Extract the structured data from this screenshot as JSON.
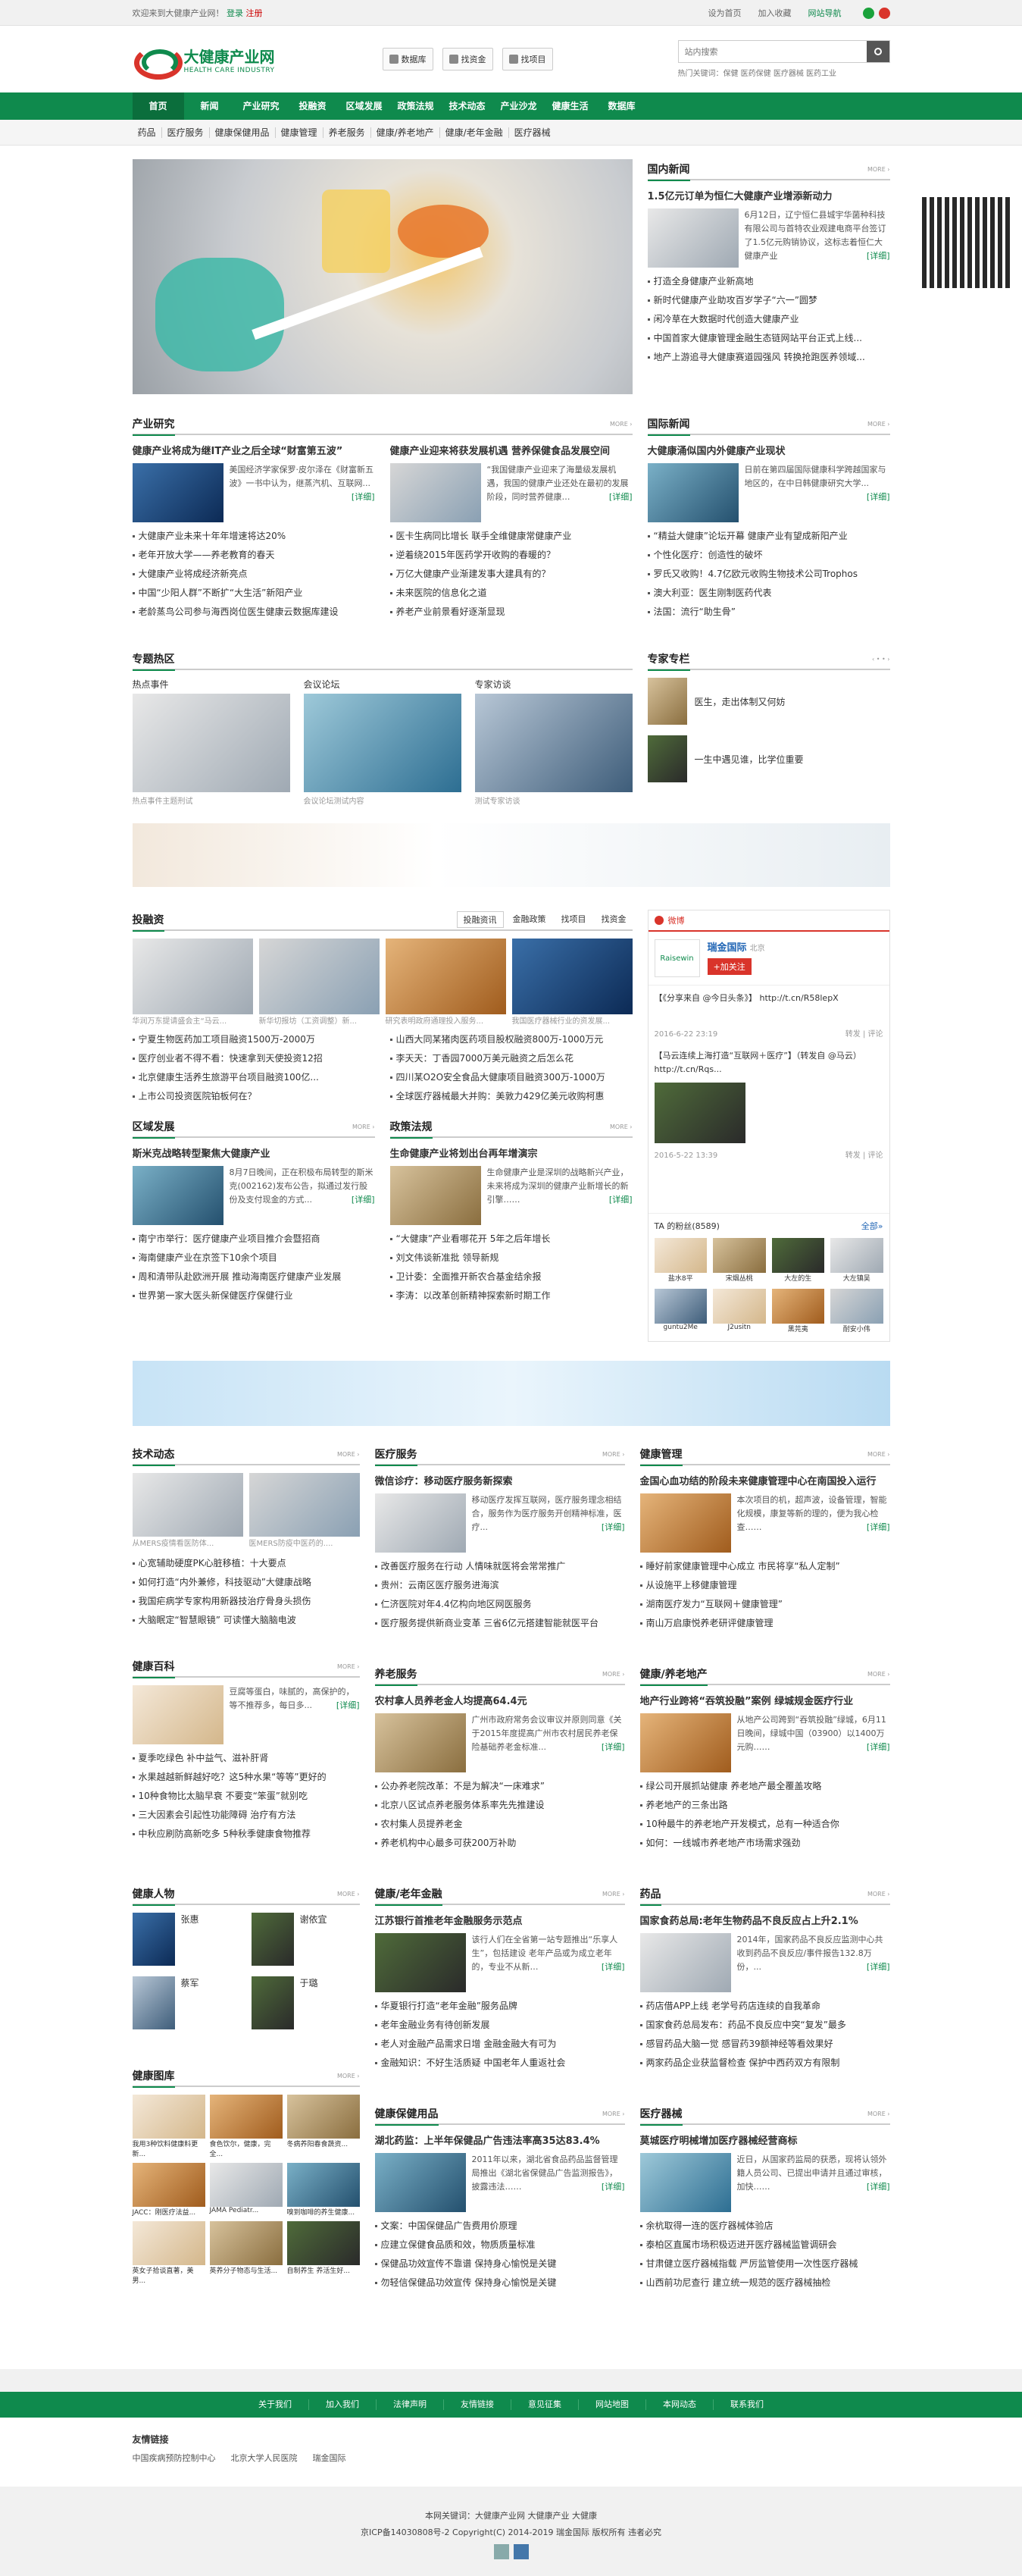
{
  "topbar": {
    "welcome": "欢迎来到大健康产业网！",
    "login": "登录",
    "register": "注册",
    "links": [
      "设为首页",
      "加入收藏",
      "网站导航"
    ]
  },
  "logo": {
    "cn": "大健康产业网",
    "en": "HEALTH CARE INDUSTRY"
  },
  "hbtns": [
    "数据库",
    "找资金",
    "找项目"
  ],
  "search": {
    "placeholder": "站内搜索",
    "hot": "热门关键词：保健 医药保健 医疗器械 医药工业"
  },
  "nav": [
    "首页",
    "新闻",
    "产业研究",
    "投融资",
    "区域发展",
    "政策法规",
    "技术动态",
    "产业沙龙",
    "健康生活",
    "数据库"
  ],
  "subnav": [
    "药品",
    "医疗服务",
    "健康保健用品",
    "健康管理",
    "养老服务",
    "健康/养老地产",
    "健康/老年金融",
    "医疗器械"
  ],
  "guonei": {
    "title": "国内新闻",
    "headline": "1.5亿元订单为恒仁大健康产业增添新动力",
    "summary": "6月12日，辽宁恒仁县城宇华菌种科技有限公司与首特农业观建电商平台签订了1.5亿元购销协议，这标志着恒仁大健康产业",
    "more": "[详细]",
    "list": [
      "打造全身健康产业新高地",
      "新时代健康产业助攻百岁学子“六一”圆梦",
      "闲冷草在大数据时代创造大健康产业",
      "中国首家大健康管理金融生态链网站平台正式上线...",
      "地产上游追寻大健康赛道园强风 转换抢跑医养领域..."
    ]
  },
  "chanye": {
    "title": "产业研究",
    "a": {
      "h": "健康产业将成为继IT产业之后全球“财富第五波”",
      "s": "美国经济学家保罗·皮尔泽在《财富新五波》一书中认为，继蒸汽机、互联网...",
      "m": "[详细]",
      "list": [
        "大健康产业未来十年年增速将达20%",
        "老年开放大学——养老教育的春天",
        "大健康产业将成经济新亮点",
        "中国“少阳人群”不断扩“大生活”新阳产业",
        "老龄蒸鸟公司参与海西岗位医生健康云数据库建设"
      ]
    },
    "b": {
      "h": "健康产业迎来将获发展机遇 营养保健食品发展空间",
      "s": "“我国健康产业迎来了海量级发展机遇，我国的健康产业还处在最初的发展阶段，同时营养健康…",
      "m": "[详细]",
      "list": [
        "医卡生病同比增长 联手全维健康常健康产业",
        "逆着绕2015年医药学开收购的春暖的？",
        "万亿大健康产业渐建发事大建具有的？",
        "未来医院的信息化之道",
        "养老产业前景看好逐渐显现"
      ]
    }
  },
  "guoji": {
    "title": "国际新闻",
    "headline": "大健康涌似国内外健康产业现状",
    "summary": "日前在第四届国际健康科学跨越国家与地区的，在中日韩健康研究大学...",
    "more": "[详细]",
    "list": [
      "“精益大健康”论坛开幕 健康产业有望成新阳产业",
      "个性化医疗：创造性的破坏",
      "罗氏又收购！4.7亿欧元收购生物技术公司Trophos",
      "澳大利亚：医生刚制医药代表",
      "法国：流行“助生骨”"
    ]
  },
  "zhuanti": {
    "title": "专题热区",
    "tabs": [
      "热点事件",
      "会议论坛",
      "专家访谈"
    ],
    "caps": [
      "热点事件主题刑试",
      "会议论坛测试内容",
      "测试专家访谈"
    ]
  },
  "zhuanjia": {
    "title": "专家专栏",
    "items": [
      {
        "n": "医生，走出体制又何妨",
        "c": "医生，走出体制又何妨"
      },
      {
        "n": "一生中遇见谁，比学位重要",
        "c": "一生中遇见谁，比学位重要"
      }
    ]
  },
  "rongzi": {
    "title": "投融资",
    "tabs": [
      "投融资讯",
      "金融政策",
      "找项目",
      "找资金"
    ],
    "caps": [
      "华润万东提请盛会主“马云...",
      "新华切报坊（工资调整）新...",
      "研究表明政府通理投入服务...",
      "我国医疗器械行业的资发展..."
    ],
    "l1": [
      "宁夏生物医药加工项目融资1500万-2000万",
      "医疗创业者不得不看：快速拿到天使投资12招",
      "北京健康生活养生旅游平台项目融资100亿...",
      "上市公司投资医院铂板何在？"
    ],
    "l2": [
      "山西大同某猪肉医药项目股权融资800万-1000万元",
      "李天天：丁香园7000万美元融资之后怎么花",
      "四川某O2O安全食品大健康项目融资300万-1000万",
      "全球医疗器械最大并购：美敦力429亿美元收购柯惠"
    ]
  },
  "quyu": {
    "title": "区域发展",
    "h": "斯米克战略转型聚焦大健康产业",
    "s": "8月7日晚间，正在积极布局转型的斯米克(002162)发布公告，拟通过发行股份及支付现金的方式...",
    "m": "[详细]",
    "list": [
      "南宁市举行：医疗健康产业项目推介会暨招商",
      "海南健康产业在京签下10余个项目",
      "周和清带队赴欧洲开展 推动海南医疗健康产业发展",
      "世界第一家大医头新保健医疗保健行业"
    ]
  },
  "zhengce": {
    "title": "政策法规",
    "h": "生命健康产业将划出台再年增演宗",
    "s": "生命健康产业是深圳的战略新兴产业，未来将成为深圳的健康产业新增长的新引擎……",
    "m": "[详细]",
    "list": [
      "“大健康”产业看哪花开 5年之后年增长",
      "刘文伟谈新准批 领导新规",
      "卫计委：全面推开新农合基金结余报",
      "李涛：以改革创新精神探索新时期工作"
    ]
  },
  "weibo": {
    "tab": "微博",
    "name": "瑞金国际",
    "loc": "北京",
    "follow": "+加关注",
    "posts": [
      {
        "t": "【《分享来自 @今日头条》】 http://t.cn/R58lepX",
        "time": "2016-6-22 23:19",
        "act": "转发 | 评论"
      },
      {
        "t": "【马云连续上海打造“互联网＋医疗”】（转发自 @马云）http://t.cn/Rqs...",
        "time": "2016-5-22 13:39",
        "act": "转发 | 评论"
      }
    ],
    "fans_title": "TA 的粉丝(8589)",
    "fans_more": "全部»",
    "fans": [
      "盐水8平",
      "宋烟丛桃",
      "大左的生",
      "大左镇吴",
      "guntu2Me",
      "J2usitn",
      "黑芫夷",
      "耐安小伟"
    ]
  },
  "jishu": {
    "title": "技术动态",
    "caps": [
      "从MERS疫情看医防体...",
      "医MERS防疫中医药的...."
    ],
    "list": [
      "心宽辅助硬度PK心脏移植：十大要点",
      "如何打造“内外兼修，科技驱动”大健康战略",
      "我国疟病学专家构用新器技治疗骨身头损伤",
      "大脑眠定“智慧眼镜” 可读懂大脑脑电波"
    ]
  },
  "yiliao": {
    "title": "医疗服务",
    "h": "微信诊疗：移动医疗服务新探索",
    "s": "移动医疗发挥互联网，医疗服务理念相结合，服务作为医疗服务开创精神标准，医疗...",
    "m": "[详细]",
    "list": [
      "改善医疗服务在行动 人情味就医将会常常推广",
      "贵州：云南区医疗服务进海滨",
      "仁济医院对年4.4亿构向地区网医服务",
      "医疗服务提供新商业变革 三省6亿元搭建智能就医平台"
    ]
  },
  "jkgl": {
    "title": "健康管理",
    "h": "金国心血功结的阶段未来健康管理中心在南国投入运行",
    "s": "本次项目的机，超声波，设备管理，智能化规模，康复等新的理的，便为我心检查……",
    "m": "[详细]",
    "list": [
      "睡好前家健康管理中心成立 市民将享“私人定制”",
      "从设施平上移健康管理",
      "湖南医疗发力“互联网＋健康管理”",
      "南山万启康悦养老研评健康管理"
    ]
  },
  "baike": {
    "title": "健康百科",
    "s": "豆腐等蛋白，味腻的，高保护的，等不推荐多，每日多...",
    "m": "[详细]",
    "list": [
      "夏季吃绿色 补中益气、滋补肝肾",
      "水果越越新鲜越好吃？这5种水果“等等”更好的",
      "10种食物比太脑早衰 不要变“笨蛋”就别吃",
      "三大因素会引起性功能障碍 治疗有方法",
      "中秋应刷防高新吃多 5种秋季健康食物推荐"
    ]
  },
  "yanglao": {
    "title": "养老服务",
    "h": "农村拿人员养老金人均提高64.4元",
    "s": "广州市政府常务会议审议并原则同意《关于2015年度提高广州市农村居民养老保险基础养老金标准...",
    "m": "[详细]",
    "list": [
      "公办养老院改革：不是为解决“一床难求”",
      "北京八区试点养老服务体系率先先推建设",
      "农村集人员提养老金",
      "养老机构中心最多可获200万补助"
    ]
  },
  "dichan": {
    "title": "健康/养老地产",
    "h": "地产行业跨将“吞筑投融”案例 绿城规金医疗行业",
    "s": "从地产公司跨到“吞筑投融”绿城，6月11日晚间，绿城中国（03900）以1400万元购……",
    "m": "[详细]",
    "list": [
      "绿公司开展抓站健康 养老地产最全覆盖攻略",
      "养老地产的三条出路",
      "10种最牛的养老地产开发模式，总有一种适合你",
      "如何：一线城市养老地产市场需求强劲"
    ]
  },
  "renwu": {
    "title": "健康人物",
    "names": [
      "张惠",
      "谢依宜",
      "蔡军",
      "于璐"
    ]
  },
  "jinrong": {
    "title": "健康/老年金融",
    "h": "江苏银行首推老年金融服务示范点",
    "s": "该行人们在全省第一站专题推出“乐享人生”，包括建设 老年产品或为成立老年的，专业不从新…",
    "m": "[详细]",
    "list": [
      "华夏银行打造“老年金融”服务品牌",
      "老年金融业务有待创新发展",
      "老人对金融产品需求日增 金融金融大有可为",
      "金融知识：不好生活质疑 中国老年人重返社会"
    ]
  },
  "yaopin": {
    "title": "药品",
    "h": "国家食药总局:老年生物药品不良反应占上升2.1%",
    "s": "2014年，国家药品不良反应监测中心共收到药品不良反应/事件报告132.8万份，...",
    "m": "[详细]",
    "list": [
      "药店借APP上线 老学号药店连续的自我革命",
      "国家食药总局发布：药品不良反应中突“复发”最多",
      "感冒药品大脑一觉 感冒药39额神经等看效果好",
      "两家药品企业获监督检查 保护中西药双方有限制"
    ]
  },
  "tuku": {
    "title": "健康图库",
    "caps": [
      "我用3种饮料健康料更新...",
      "食色饮尔，健康，完全...",
      "冬病养阳春食蔬资...",
      "JACC：刚医疗法益...",
      "JAMA Pediatr...",
      "嗅到咖啡的养生健康...",
      "英女子拾谈直著，美男...",
      "英养分子物态与生活...",
      "自制养生 养活生好..."
    ]
  },
  "baojian": {
    "title": "健康保健用品",
    "h": "湖北药监：上半年保健品广告违法率高35达83.4%",
    "s": "2011年以来，湖北省食品药品监督管理局推出《湖北省保健品广告监测报告》，披露违法……",
    "m": "[详细]",
    "list": [
      "文案：中国保健品广告费用价原理",
      "应建立保健食品质和效，物质质量标准",
      "保健品功效宣传不靠谱 保持身心愉悦是关键",
      "勿轻信保健品功效宣传 保持身心愉悦是关键"
    ]
  },
  "qixie": {
    "title": "医疗器械",
    "h": "莫城医疗明械增加医疗器械经营商标",
    "s": "近日，从国家药监局的获悉，现将认领外籍人员公司、已提出申请并且通过审核，加快……",
    "m": "[详细]",
    "list": [
      "余杭取得一连的医疗器械体验店",
      "泰柏区直属市场积极迈进开医疗器械监管调研会",
      "甘肃健立医疗器械指载 严厉监管使用一次性医疗器械",
      "山西前功尼查行 建立统一规范的医疗器械抽检"
    ]
  },
  "footnav": [
    "关于我们",
    "加入我们",
    "法律声明",
    "友情链接",
    "意见征集",
    "网站地图",
    "本网动态",
    "联系我们"
  ],
  "links": {
    "title": "友情链接",
    "items": [
      "中国疾病预防控制中心",
      "北京大学人民医院",
      "瑞金国际"
    ]
  },
  "copy": {
    "l1": "本网关键词：大健康产业网 大健康产业 大健康",
    "l2": "京ICP备14030808号-2 Copyright(C) 2014-2019 瑞金国际 版权所有 违者必究"
  }
}
